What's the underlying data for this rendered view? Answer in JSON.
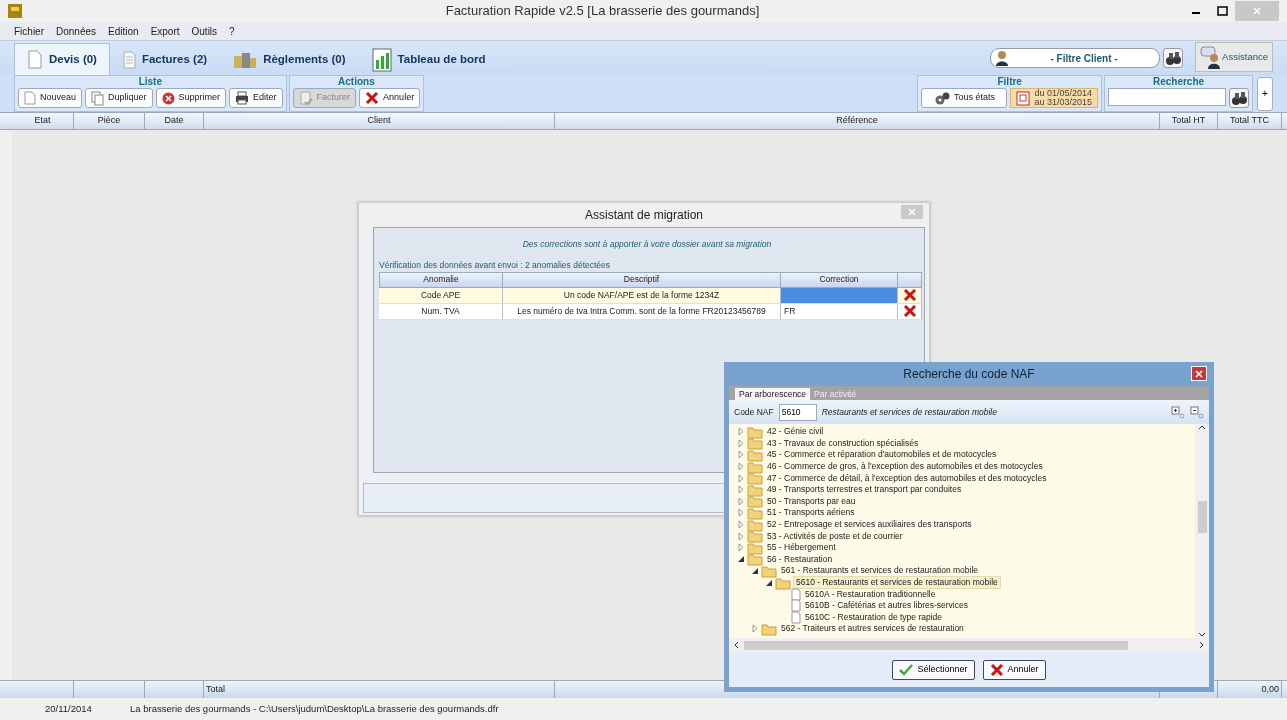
{
  "window": {
    "title": "Facturation Rapide v2.5 [La brasserie des gourmands]"
  },
  "menu": [
    "Fichier",
    "Données",
    "Edition",
    "Export",
    "Outils",
    "?"
  ],
  "tabs": [
    {
      "label": "Devis (0)",
      "kind": "quote",
      "selected": true
    },
    {
      "label": "Factures (2)",
      "kind": "invoice",
      "selected": false
    },
    {
      "label": "Règlements (0)",
      "kind": "payment",
      "selected": false
    },
    {
      "label": "Tableau de bord",
      "kind": "dashboard",
      "selected": false
    }
  ],
  "client_filter": {
    "value": "- Filtre Client -"
  },
  "assist_button": "Assistance",
  "toolbar_groups": [
    {
      "title": "Liste",
      "buttons": [
        {
          "label": "Nouveau",
          "kind": "new",
          "disabled": false
        },
        {
          "label": "Dupliquer",
          "kind": "copy",
          "disabled": false
        },
        {
          "label": "Supprimer",
          "kind": "delete",
          "disabled": false
        },
        {
          "label": "Editer",
          "kind": "print",
          "disabled": false
        }
      ]
    },
    {
      "title": "Actions",
      "buttons": [
        {
          "label": "Facturer",
          "kind": "invoice",
          "disabled": true
        },
        {
          "label": "Annuler",
          "kind": "cancel",
          "disabled": false
        }
      ]
    }
  ],
  "filter": {
    "title": "Filtre",
    "state_button": "Tous états",
    "date_range": [
      "du 01/05/2014",
      "au 31/03/2015"
    ]
  },
  "search": {
    "title": "Recherche"
  },
  "add_button": "+",
  "table": {
    "columns": [
      "Etat",
      "Pièce",
      "Date",
      "Client",
      "Référence",
      "Total HT",
      "Total TTC"
    ]
  },
  "totals": {
    "label": "Total",
    "total_ttc": "0,00"
  },
  "status_bar": {
    "date": "20/11/2014",
    "file": "La brasserie des gourmands - C:\\Users\\judum\\Desktop\\La brasserie des gourmands.dfr"
  },
  "migration_dialog": {
    "title": "Assistant de migration",
    "message": "Des corrections sont à apporter à votre dossier avant sa migration",
    "check_line": "Vérification des données avant envoi  : 2 anomalies détectées",
    "columns": [
      "Anomalie",
      "Descriptif",
      "Correction"
    ],
    "rows": [
      {
        "anomaly": "Code APE",
        "description": "Un code NAF/APE est de la forme 1234Z",
        "correction": "",
        "selected": true
      },
      {
        "anomaly": "Num. TVA",
        "description": "Les numéro de tva Intra Comm. sont de la forme FR20123456789",
        "correction": "FR",
        "selected": false
      }
    ]
  },
  "naf_dialog": {
    "title": "Recherche du code NAF",
    "tabs": [
      {
        "label": "Par arborescence",
        "selected": true
      },
      {
        "label": "Par activité",
        "selected": false
      }
    ],
    "code_label": "Code NAF",
    "code": "5610",
    "code_description": "Restaurants et services de restauration mobile",
    "tree": [
      {
        "label": "42 - Génie civil",
        "kind": "folder",
        "expanded": false,
        "selected": false
      },
      {
        "label": "43 - Travaux de construction spécialisés",
        "kind": "folder",
        "expanded": false,
        "selected": false
      },
      {
        "label": "45 - Commerce et réparation d'automobiles et de motocycles",
        "kind": "folder",
        "expanded": false,
        "selected": false
      },
      {
        "label": "46 - Commerce de gros, à l'exception des automobiles et des motocycles",
        "kind": "folder",
        "expanded": false,
        "selected": false
      },
      {
        "label": "47 - Commerce de détail, à l'exception des automobiles et des motocycles",
        "kind": "folder",
        "expanded": false,
        "selected": false
      },
      {
        "label": "49 - Transports terrestres et transport par conduites",
        "kind": "folder",
        "expanded": false,
        "selected": false
      },
      {
        "label": "50 - Transports par eau",
        "kind": "folder",
        "expanded": false,
        "selected": false
      },
      {
        "label": "51 - Transports aériens",
        "kind": "folder",
        "expanded": false,
        "selected": false
      },
      {
        "label": "52 - Entreposage et services auxiliaires des transports",
        "kind": "folder",
        "expanded": false,
        "selected": false
      },
      {
        "label": "53 - Activités de poste et de courrier",
        "kind": "folder",
        "expanded": false,
        "selected": false
      },
      {
        "label": "55 - Hébergement",
        "kind": "folder",
        "expanded": false,
        "selected": false
      },
      {
        "label": "56 - Restauration",
        "kind": "folder",
        "expanded": true,
        "selected": false,
        "children": [
          {
            "label": "561 - Restaurants et services de restauration mobile",
            "kind": "folder",
            "expanded": true,
            "selected": false,
            "children": [
              {
                "label": "5610 - Restaurants et services de restauration mobile",
                "kind": "folder",
                "expanded": true,
                "selected": true,
                "children": [
                  {
                    "label": "5610A - Restauration traditionnelle",
                    "kind": "document",
                    "selected": false
                  },
                  {
                    "label": "5610B - Cafétérias et autres libres-services",
                    "kind": "document",
                    "selected": false
                  },
                  {
                    "label": "5610C - Restauration de type rapide",
                    "kind": "document",
                    "selected": false
                  }
                ]
              }
            ]
          },
          {
            "label": "562 - Traiteurs et autres services de restauration",
            "kind": "folder",
            "expanded": false,
            "selected": false
          }
        ]
      }
    ],
    "buttons": [
      {
        "label": "Sélectionner",
        "kind": "ok"
      },
      {
        "label": "Annuler",
        "kind": "cancel"
      }
    ]
  }
}
